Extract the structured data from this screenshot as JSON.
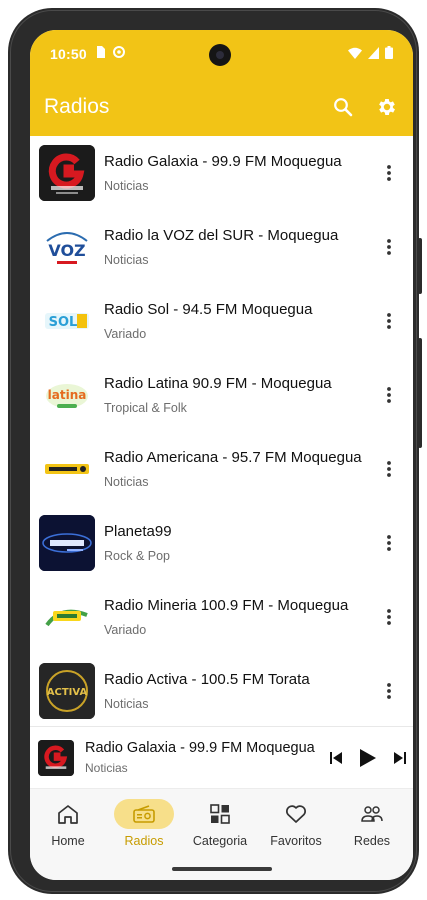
{
  "status_bar": {
    "time": "10:50"
  },
  "app_bar": {
    "title": "Radios"
  },
  "stations": [
    {
      "name": "Radio Galaxia - 99.9 FM Moquegua",
      "genre": "Noticias"
    },
    {
      "name": "Radio la VOZ del SUR - Moquegua",
      "genre": "Noticias"
    },
    {
      "name": "Radio Sol - 94.5 FM Moquegua",
      "genre": "Variado"
    },
    {
      "name": "Radio Latina 90.9 FM - Moquegua",
      "genre": "Tropical & Folk"
    },
    {
      "name": "Radio Americana - 95.7 FM Moquegua",
      "genre": "Noticias"
    },
    {
      "name": "Planeta99",
      "genre": "Rock & Pop"
    },
    {
      "name": "Radio Mineria 100.9 FM - Moquegua",
      "genre": "Variado"
    },
    {
      "name": "Radio Activa - 100.5 FM Torata",
      "genre": "Noticias"
    }
  ],
  "logos": {
    "voz": "VOZ",
    "sol": "SOL",
    "latina": "latina",
    "activa": "ACTIVA"
  },
  "now_playing": {
    "title": "Radio Galaxia - 99.9 FM Moquegua",
    "subtitle": "Noticias"
  },
  "nav": [
    {
      "label": "Home",
      "icon": "home-icon",
      "active": false
    },
    {
      "label": "Radios",
      "icon": "radio-icon",
      "active": true
    },
    {
      "label": "Categoria",
      "icon": "category-icon",
      "active": false
    },
    {
      "label": "Favoritos",
      "icon": "heart-icon",
      "active": false
    },
    {
      "label": "Redes",
      "icon": "people-icon",
      "active": false
    }
  ],
  "colors": {
    "accent": "#f2c416",
    "active_pill": "#f7df8a",
    "active_label": "#c79c00"
  }
}
